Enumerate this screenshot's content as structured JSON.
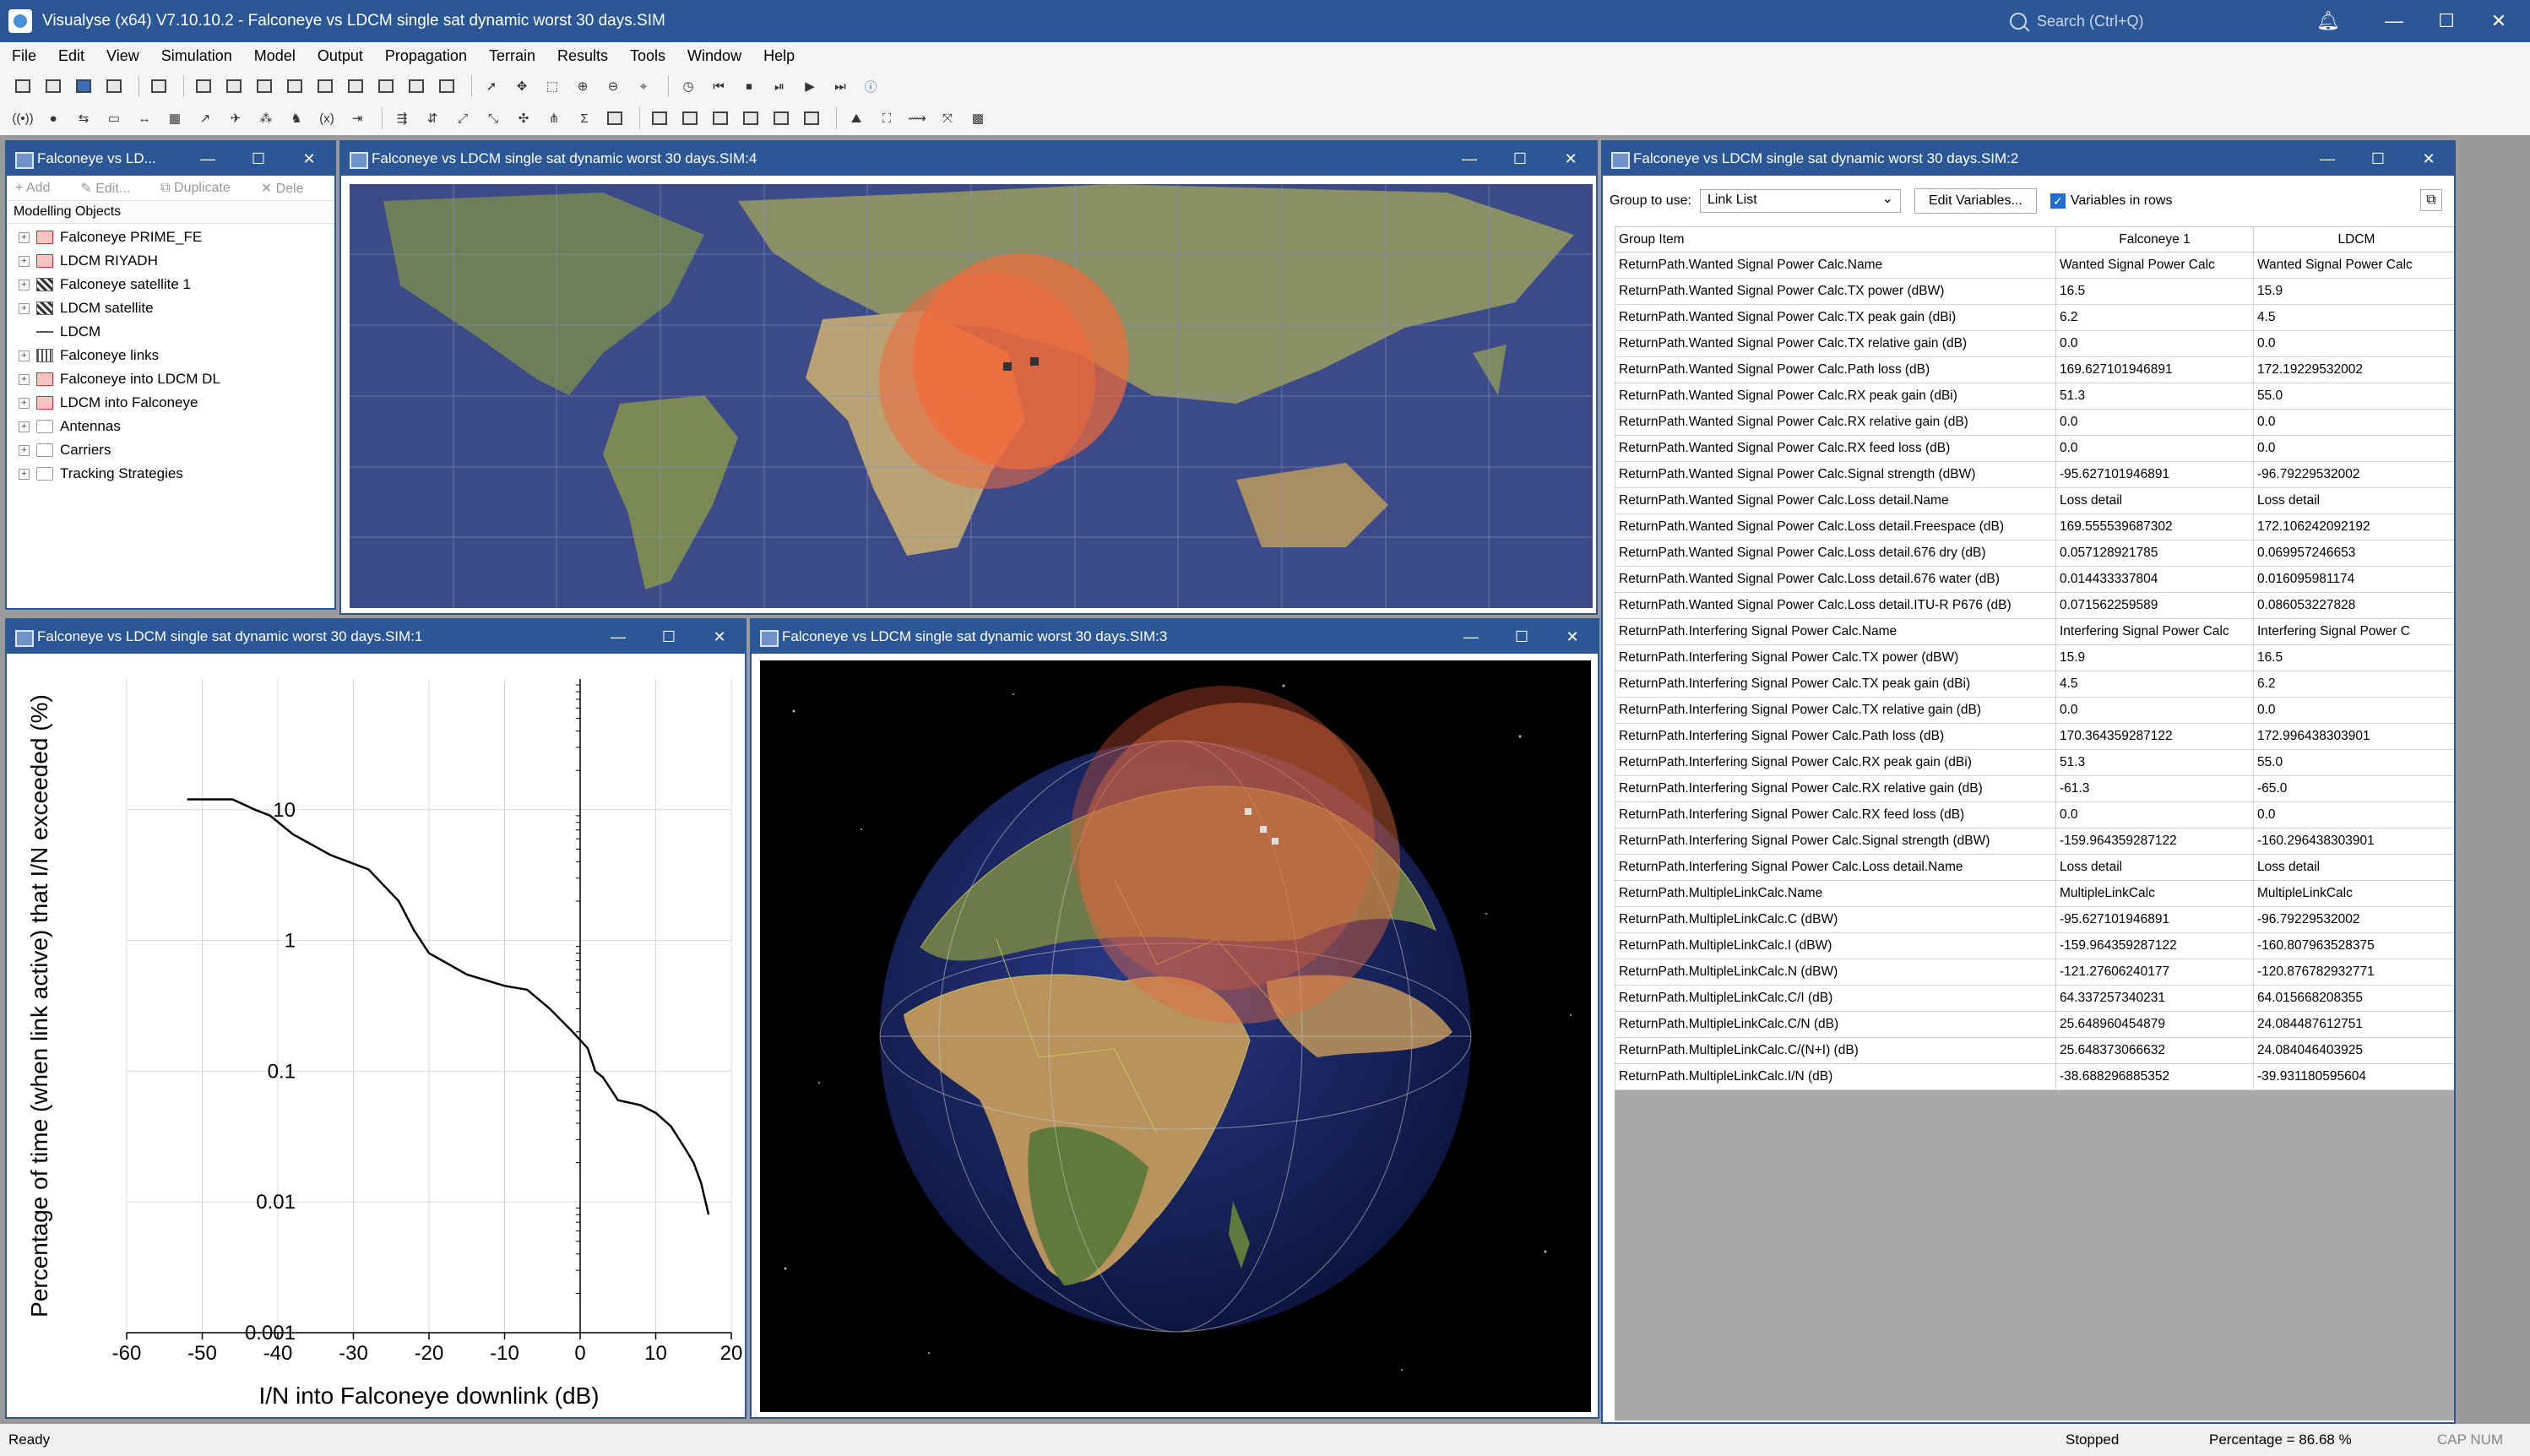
{
  "window": {
    "title": "Visualyse (x64) V7.10.10.2 - Falconeye vs LDCM single sat dynamic worst 30 days.SIM",
    "search_placeholder": "Search (Ctrl+Q)"
  },
  "menu": [
    "File",
    "Edit",
    "View",
    "Simulation",
    "Model",
    "Output",
    "Propagation",
    "Terrain",
    "Results",
    "Tools",
    "Window",
    "Help"
  ],
  "tree": {
    "title": "Falconeye vs LD...",
    "toolbar": [
      "Add",
      "Edit...",
      "Duplicate",
      "Dele"
    ],
    "header": "Modelling Objects",
    "items": [
      {
        "label": "Falconeye PRIME_FE",
        "icon": "station-icon"
      },
      {
        "label": "LDCM RIYADH",
        "icon": "station-icon"
      },
      {
        "label": "Falconeye satellite 1",
        "icon": "satellite-icon"
      },
      {
        "label": "LDCM satellite",
        "icon": "satellite-icon"
      },
      {
        "label": "LDCM",
        "icon": "link-icon"
      },
      {
        "label": "Falconeye links",
        "icon": "link-group-icon"
      },
      {
        "label": "Falconeye into LDCM DL",
        "icon": "interference-icon"
      },
      {
        "label": "LDCM into Falconeye",
        "icon": "interference-icon"
      },
      {
        "label": "Antennas",
        "icon": "folder-icon"
      },
      {
        "label": "Carriers",
        "icon": "folder-icon"
      },
      {
        "label": "Tracking Strategies",
        "icon": "folder-icon"
      }
    ]
  },
  "map_window": {
    "title": "Falconeye vs LDCM single sat dynamic worst 30 days.SIM:4"
  },
  "plot_window": {
    "title": "Falconeye vs LDCM single sat dynamic worst 30 days.SIM:1"
  },
  "globe_window": {
    "title": "Falconeye vs LDCM single sat dynamic worst 30 days.SIM:3"
  },
  "table_window": {
    "title": "Falconeye vs LDCM single sat dynamic worst 30 days.SIM:2",
    "group_label": "Group to use:",
    "group_value": "Link List",
    "edit_button": "Edit Variables...",
    "rows_checkbox": "Variables in rows",
    "columns": [
      "Group Item",
      "Falconeye 1",
      "LDCM"
    ],
    "rows": [
      [
        "ReturnPath.Wanted Signal Power Calc.Name",
        "Wanted Signal Power Calc",
        "Wanted Signal Power Calc"
      ],
      [
        "ReturnPath.Wanted Signal Power Calc.TX power (dBW)",
        "16.5",
        "15.9"
      ],
      [
        "ReturnPath.Wanted Signal Power Calc.TX peak gain (dBi)",
        "6.2",
        "4.5"
      ],
      [
        "ReturnPath.Wanted Signal Power Calc.TX relative gain (dB)",
        "0.0",
        "0.0"
      ],
      [
        "ReturnPath.Wanted Signal Power Calc.Path loss (dB)",
        "169.627101946891",
        "172.19229532002"
      ],
      [
        "ReturnPath.Wanted Signal Power Calc.RX peak gain (dBi)",
        "51.3",
        "55.0"
      ],
      [
        "ReturnPath.Wanted Signal Power Calc.RX relative gain (dB)",
        "0.0",
        "0.0"
      ],
      [
        "ReturnPath.Wanted Signal Power Calc.RX feed loss (dB)",
        "0.0",
        "0.0"
      ],
      [
        "ReturnPath.Wanted Signal Power Calc.Signal strength (dBW)",
        "-95.627101946891",
        "-96.79229532002"
      ],
      [
        "ReturnPath.Wanted Signal Power Calc.Loss detail.Name",
        "Loss detail",
        "Loss detail"
      ],
      [
        "ReturnPath.Wanted Signal Power Calc.Loss detail.Freespace (dB)",
        "169.555539687302",
        "172.106242092192"
      ],
      [
        "ReturnPath.Wanted Signal Power Calc.Loss detail.676 dry (dB)",
        "0.057128921785",
        "0.069957246653"
      ],
      [
        "ReturnPath.Wanted Signal Power Calc.Loss detail.676 water (dB)",
        "0.014433337804",
        "0.016095981174"
      ],
      [
        "ReturnPath.Wanted Signal Power Calc.Loss detail.ITU-R P676 (dB)",
        "0.071562259589",
        "0.086053227828"
      ],
      [
        "ReturnPath.Interfering Signal Power Calc.Name",
        "Interfering Signal Power Calc",
        "Interfering Signal Power C"
      ],
      [
        "ReturnPath.Interfering Signal Power Calc.TX power (dBW)",
        "15.9",
        "16.5"
      ],
      [
        "ReturnPath.Interfering Signal Power Calc.TX peak gain (dBi)",
        "4.5",
        "6.2"
      ],
      [
        "ReturnPath.Interfering Signal Power Calc.TX relative gain (dB)",
        "0.0",
        "0.0"
      ],
      [
        "ReturnPath.Interfering Signal Power Calc.Path loss (dB)",
        "170.364359287122",
        "172.996438303901"
      ],
      [
        "ReturnPath.Interfering Signal Power Calc.RX peak gain (dBi)",
        "51.3",
        "55.0"
      ],
      [
        "ReturnPath.Interfering Signal Power Calc.RX relative gain (dB)",
        "-61.3",
        "-65.0"
      ],
      [
        "ReturnPath.Interfering Signal Power Calc.RX feed loss (dB)",
        "0.0",
        "0.0"
      ],
      [
        "ReturnPath.Interfering Signal Power Calc.Signal strength (dBW)",
        "-159.964359287122",
        "-160.296438303901"
      ],
      [
        "ReturnPath.Interfering Signal Power Calc.Loss detail.Name",
        "Loss detail",
        "Loss detail"
      ],
      [
        "ReturnPath.MultipleLinkCalc.Name",
        "MultipleLinkCalc",
        "MultipleLinkCalc"
      ],
      [
        "ReturnPath.MultipleLinkCalc.C (dBW)",
        "-95.627101946891",
        "-96.79229532002"
      ],
      [
        "ReturnPath.MultipleLinkCalc.I (dBW)",
        "-159.964359287122",
        "-160.807963528375"
      ],
      [
        "ReturnPath.MultipleLinkCalc.N (dBW)",
        "-121.27606240177",
        "-120.876782932771"
      ],
      [
        "ReturnPath.MultipleLinkCalc.C/I (dB)",
        "64.337257340231",
        "64.015668208355"
      ],
      [
        "ReturnPath.MultipleLinkCalc.C/N (dB)",
        "25.648960454879",
        "24.084487612751"
      ],
      [
        "ReturnPath.MultipleLinkCalc.C/(N+I) (dB)",
        "25.648373066632",
        "24.084046403925"
      ],
      [
        "ReturnPath.MultipleLinkCalc.I/N (dB)",
        "-38.688296885352",
        "-39.931180595604"
      ]
    ]
  },
  "chart_data": {
    "type": "line",
    "xlabel": "I/N into Falconeye downlink (dB)",
    "ylabel": "Percentage of time (when link active) that I/N exceeded (%)",
    "xlim": [
      -60,
      20
    ],
    "ylim": [
      0.001,
      100
    ],
    "yscale": "log",
    "grid": true,
    "x_ticks": [
      "-60",
      "-50",
      "-40",
      "-30",
      "-20",
      "-10",
      "0",
      "10",
      "20"
    ],
    "y_ticks": [
      "10",
      "1",
      "0.1",
      "0.01",
      "0.001"
    ],
    "series": [
      {
        "x": [
          -52,
          -46,
          -43,
          -41,
          -38,
          -33,
          -28,
          -24,
          -22,
          -20,
          -15,
          -10,
          -7,
          -4,
          -1,
          1,
          2,
          3,
          5,
          8,
          10,
          12,
          14,
          15,
          16,
          17
        ],
        "y": [
          12,
          12,
          10,
          9,
          6.5,
          4.5,
          3.5,
          2,
          1.2,
          0.8,
          0.55,
          0.45,
          0.42,
          0.3,
          0.2,
          0.15,
          0.1,
          0.09,
          0.06,
          0.055,
          0.048,
          0.038,
          0.025,
          0.02,
          0.014,
          0.008
        ]
      }
    ]
  },
  "status": {
    "left": "Ready",
    "state": "Stopped",
    "percentage": "Percentage = 86.68 %",
    "caps": "CAP NUM"
  }
}
